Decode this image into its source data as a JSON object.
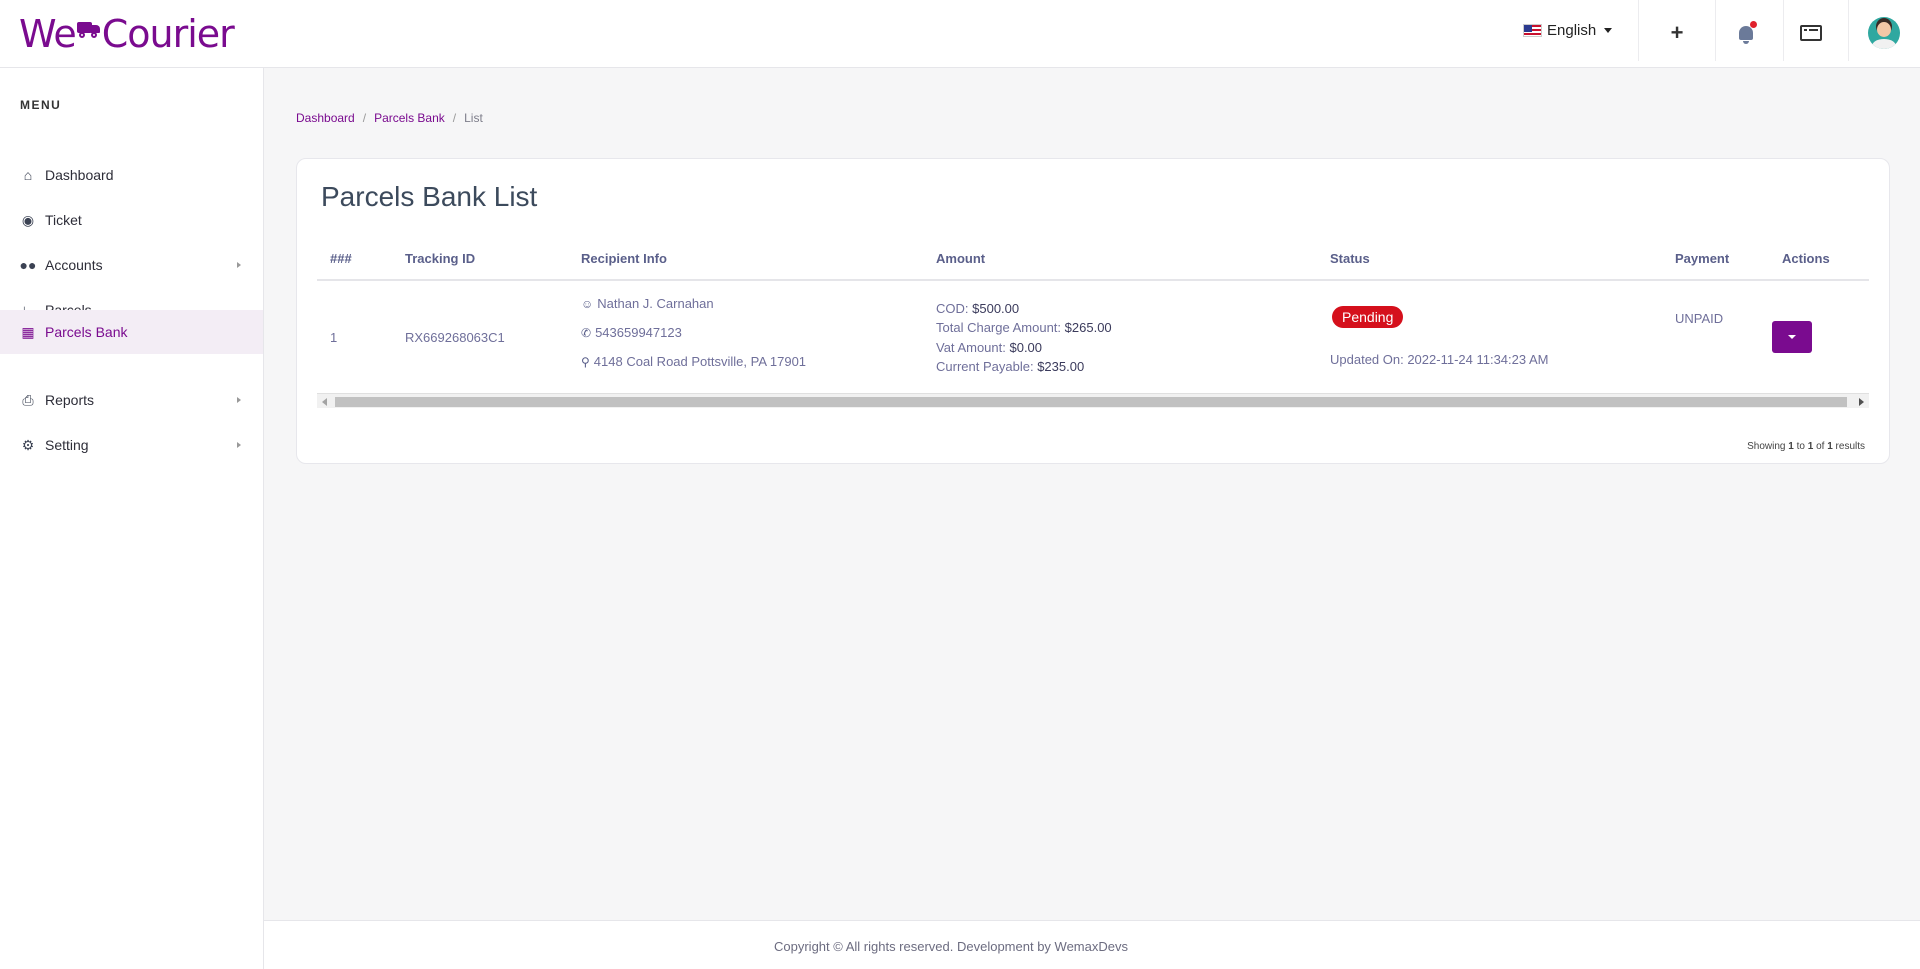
{
  "header": {
    "logo_left": "We",
    "logo_right": "Courier",
    "language": "English",
    "icons": [
      "plus-icon",
      "bell-icon",
      "list-icon",
      "avatar"
    ],
    "notification_dot_color": "#e0212c"
  },
  "sidebar": {
    "menu_title": "MENU",
    "items": [
      {
        "label": "Dashboard",
        "icon": "home-icon",
        "active": false,
        "submenu": false
      },
      {
        "label": "Ticket",
        "icon": "comments-icon",
        "active": false,
        "submenu": false
      },
      {
        "label": "Accounts",
        "icon": "users-icon",
        "active": false,
        "submenu": true
      },
      {
        "label": "Parcels",
        "icon": "dolly-icon",
        "active": false,
        "submenu": false
      },
      {
        "label": "Parcels Bank",
        "icon": "map-icon",
        "active": true,
        "submenu": false
      },
      {
        "label": "Reports",
        "icon": "print-icon",
        "active": false,
        "submenu": true
      },
      {
        "label": "Setting",
        "icon": "cogs-icon",
        "active": false,
        "submenu": true
      }
    ]
  },
  "breadcrumb": [
    "Dashboard",
    "Parcels Bank",
    "List"
  ],
  "page": {
    "title": "Parcels Bank List",
    "columns": [
      "###",
      "Tracking ID",
      "Recipient Info",
      "Amount",
      "Status",
      "Payment",
      "Actions"
    ],
    "rows": [
      {
        "index": "1",
        "tracking_id": "RX669268063C1",
        "recipient_name": "Nathan J. Carnahan",
        "recipient_phone": "543659947123",
        "recipient_address": "4148 Coal Road Pottsville, PA 17901",
        "cod_label": "COD:",
        "cod_value": "$500.00",
        "total_charge_label": "Total Charge Amount:",
        "total_charge_value": "$265.00",
        "vat_label": "Vat Amount:",
        "vat_value": "$0.00",
        "payable_label": "Current Payable:",
        "payable_value": "$235.00",
        "status": "Pending",
        "updated_on": "Updated On: 2022-11-24 11:34:23 AM",
        "payment": "UNPAID"
      }
    ],
    "showing": {
      "prefix": "Showing",
      "from": "1",
      "to_word": "to",
      "to": "1",
      "of_word": "of",
      "total": "1",
      "suffix": "results"
    }
  },
  "footer": {
    "text": "Copyright © All rights reserved. Development by WemaxDevs"
  },
  "colors": {
    "brand": "#7a0b8f",
    "status_pending": "#d5101c"
  }
}
